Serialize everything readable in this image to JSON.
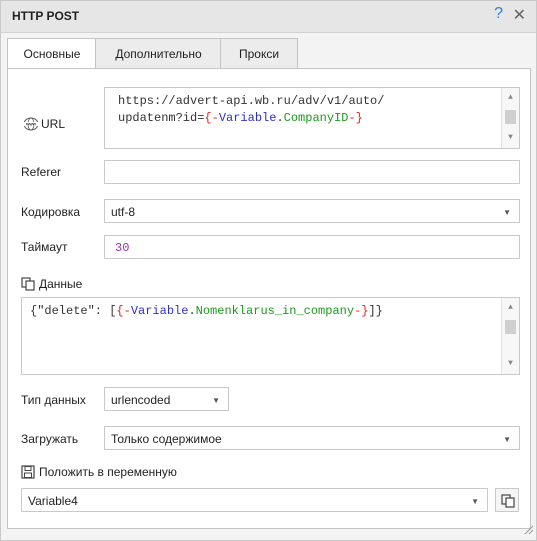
{
  "window": {
    "title": "HTTP POST",
    "help_glyph": "?",
    "close_glyph": "✕"
  },
  "tabs": [
    {
      "label": "Основные",
      "active": true
    },
    {
      "label": "Дополнительно",
      "active": false
    },
    {
      "label": "Прокси",
      "active": false
    }
  ],
  "url": {
    "label": "URL",
    "line1": "https://advert-api.wb.ru/adv/v1/auto/",
    "line2_prefix": "updatenm?id=",
    "var_open": "{-",
    "var_keyword": "Variable",
    "var_dot": ".",
    "var_name": "CompanyID",
    "var_close": "-}"
  },
  "referer": {
    "label": "Referer",
    "value": ""
  },
  "encoding": {
    "label": "Кодировка",
    "value": "utf-8"
  },
  "timeout": {
    "label": "Таймаут",
    "value": "30"
  },
  "data": {
    "label": "Данные",
    "prefix": "{\"delete\": [",
    "var_open": "{-",
    "var_keyword": "Variable",
    "var_dot": ".",
    "var_name": "Nomenklarus_in_company",
    "var_close": "-}",
    "suffix": "]}"
  },
  "data_type": {
    "label": "Тип данных",
    "value": "urlencoded"
  },
  "load": {
    "label": "Загружать",
    "value": "Только содержимое"
  },
  "save_to_var": {
    "label": "Положить в переменную",
    "value": "Variable4"
  },
  "colors": {
    "accent": "#2a7fd4",
    "var_brace": "#e0221c",
    "var_keyword": "#2e2ec8",
    "var_name": "#1a9a1a",
    "number": "#9a2fb0"
  }
}
